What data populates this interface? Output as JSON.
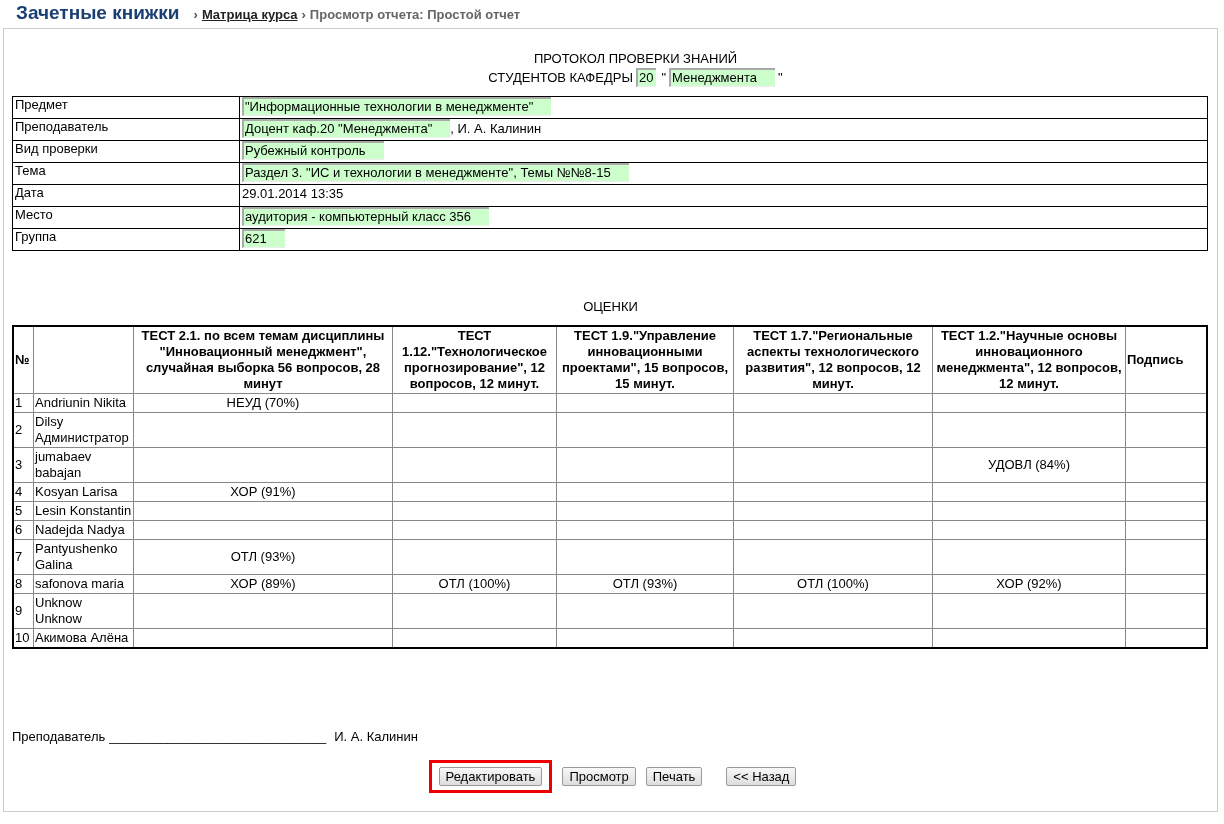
{
  "header": {
    "title": "Зачетные книжки",
    "separator": "›",
    "breadcrumbs": [
      {
        "label": "Матрица курса",
        "link": true
      },
      {
        "label": "Просмотр отчета: Простой отчет",
        "link": false
      }
    ]
  },
  "protocol": {
    "line_1": "ПРОТОКОЛ ПРОВЕРКИ ЗНАНИЙ",
    "line_2_label": "СТУДЕНТОВ КАФЕДРЫ",
    "department_number": "20",
    "quote_open": "\"",
    "department_name": "Менеджмента",
    "quote_close": "\""
  },
  "info": [
    {
      "label": "Предмет",
      "parts": [
        {
          "kind": "field",
          "value": "\"Информационные технологии в менеджменте\""
        }
      ]
    },
    {
      "label": "Преподаватель",
      "parts": [
        {
          "kind": "field",
          "value": "Доцент каф.20 \"Менеджмента\""
        },
        {
          "kind": "text",
          "value": ", И. А. Калинин"
        }
      ]
    },
    {
      "label": "Вид проверки",
      "parts": [
        {
          "kind": "field",
          "value": "Рубежный контроль"
        }
      ]
    },
    {
      "label": "Тема",
      "parts": [
        {
          "kind": "field",
          "value": "Раздел 3. \"ИС и технологии в менеджменте\", Темы №№8-15"
        }
      ]
    },
    {
      "label": "Дата",
      "parts": [
        {
          "kind": "text",
          "value": "29.01.2014 13:35"
        }
      ]
    },
    {
      "label": "Место",
      "parts": [
        {
          "kind": "field",
          "value": "аудитория - компьютерный класс 356"
        }
      ]
    },
    {
      "label": "Группа",
      "parts": [
        {
          "kind": "field",
          "value": "621"
        }
      ]
    }
  ],
  "grades": {
    "title": "ОЦЕНКИ",
    "columns": [
      "№",
      "ТЕСТ 2.1. по всем темам дисциплины \"Инновационный менеджмент\", случайная выборка 56 вопросов, 28 минут",
      "ТЕСТ 1.12.\"Технологическое прогнозирование\", 12 вопросов, 12 минут.",
      "ТЕСТ 1.9.\"Управление инновационными проектами\", 15 вопросов, 15 минут.",
      "ТЕСТ 1.7.\"Региональные аспекты технологического развития\", 12 вопросов, 12 минут.",
      "ТЕСТ 1.2.\"Научные основы инновационного менеджмента\", 12 вопросов, 12 минут.",
      "Подпись"
    ],
    "rows": [
      {
        "number": "1",
        "name": "Andriunin Nikita",
        "results": {
          "test_1": "НЕУД (70%)"
        }
      },
      {
        "number": "2",
        "name": "Dilsy Администратор",
        "results": {}
      },
      {
        "number": "3",
        "name": "jumabaev babajan",
        "results": {
          "test_5": "УДОВЛ (84%)"
        }
      },
      {
        "number": "4",
        "name": "Kosyan Larisa",
        "results": {
          "test_1": "ХОР (91%)"
        }
      },
      {
        "number": "5",
        "name": "Lesin Konstantin",
        "results": {}
      },
      {
        "number": "6",
        "name": "Nadejda Nadya",
        "results": {}
      },
      {
        "number": "7",
        "name": "Pantyushenko Galina",
        "results": {
          "test_1": "ОТЛ (93%)"
        }
      },
      {
        "number": "8",
        "name": "safonova maria",
        "results": {
          "test_1": "ХОР (89%)",
          "test_2": "ОТЛ (100%)",
          "test_3": "ОТЛ (93%)",
          "test_4": "ОТЛ (100%)",
          "test_5": "ХОР (92%)"
        }
      },
      {
        "number": "9",
        "name": "Unknow Unknow",
        "results": {}
      },
      {
        "number": "10",
        "name": "Акимова Алёна",
        "results": {}
      }
    ]
  },
  "signature": {
    "label": "Преподаватель",
    "line": "______________________________",
    "name": "И. А. Калинин"
  },
  "buttons": [
    {
      "label": "Редактировать",
      "highlighted": true
    },
    {
      "label": "Просмотр",
      "highlighted": false
    },
    {
      "label": "Печать",
      "highlighted": false
    },
    {
      "label": "<< Назад",
      "highlighted": false
    }
  ]
}
